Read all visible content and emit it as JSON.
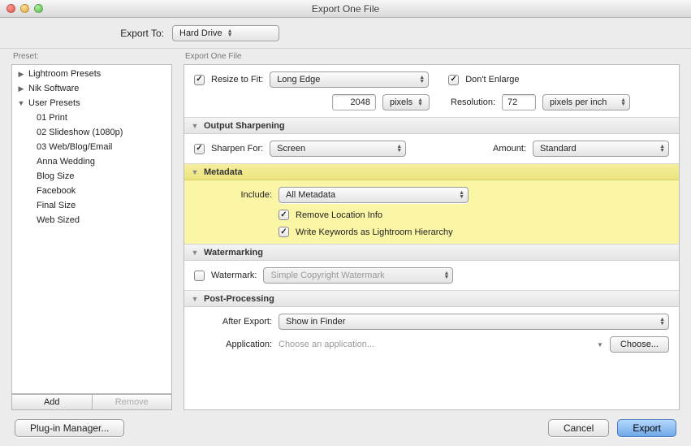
{
  "window_title": "Export One File",
  "top": {
    "label": "Export To:",
    "value": "Hard Drive"
  },
  "left": {
    "header": "Preset:",
    "items": [
      {
        "label": "Lightroom Presets",
        "kind": "group",
        "expanded": false
      },
      {
        "label": "Nik Software",
        "kind": "group",
        "expanded": false
      },
      {
        "label": "User Presets",
        "kind": "group",
        "expanded": true
      },
      {
        "label": "01 Print",
        "kind": "child"
      },
      {
        "label": "02 Slideshow (1080p)",
        "kind": "child"
      },
      {
        "label": "03 Web/Blog/Email",
        "kind": "child"
      },
      {
        "label": "Anna Wedding",
        "kind": "child"
      },
      {
        "label": "Blog Size",
        "kind": "child"
      },
      {
        "label": "Facebook",
        "kind": "child"
      },
      {
        "label": "Final Size",
        "kind": "child"
      },
      {
        "label": "Web Sized",
        "kind": "child"
      }
    ],
    "add": "Add",
    "remove": "Remove"
  },
  "right_header": "Export One File",
  "sizing": {
    "resize_label": "Resize to Fit:",
    "resize_checked": true,
    "resize_mode": "Long Edge",
    "dont_enlarge_label": "Don't Enlarge",
    "dont_enlarge_checked": true,
    "value": "2048",
    "unit": "pixels",
    "resolution_label": "Resolution:",
    "resolution_value": "72",
    "resolution_unit": "pixels per inch"
  },
  "sharpen": {
    "header": "Output Sharpening",
    "label": "Sharpen For:",
    "checked": true,
    "target": "Screen",
    "amount_label": "Amount:",
    "amount": "Standard"
  },
  "metadata": {
    "header": "Metadata",
    "include_label": "Include:",
    "include_value": "All Metadata",
    "remove_location": "Remove Location Info",
    "remove_location_checked": true,
    "write_keywords": "Write Keywords as Lightroom Hierarchy",
    "write_keywords_checked": true
  },
  "watermark": {
    "header": "Watermarking",
    "label": "Watermark:",
    "checked": false,
    "value": "Simple Copyright Watermark"
  },
  "post": {
    "header": "Post-Processing",
    "after_label": "After Export:",
    "after_value": "Show in Finder",
    "app_label": "Application:",
    "app_placeholder": "Choose an application...",
    "choose": "Choose..."
  },
  "footer": {
    "plugin": "Plug-in Manager...",
    "cancel": "Cancel",
    "export": "Export"
  }
}
